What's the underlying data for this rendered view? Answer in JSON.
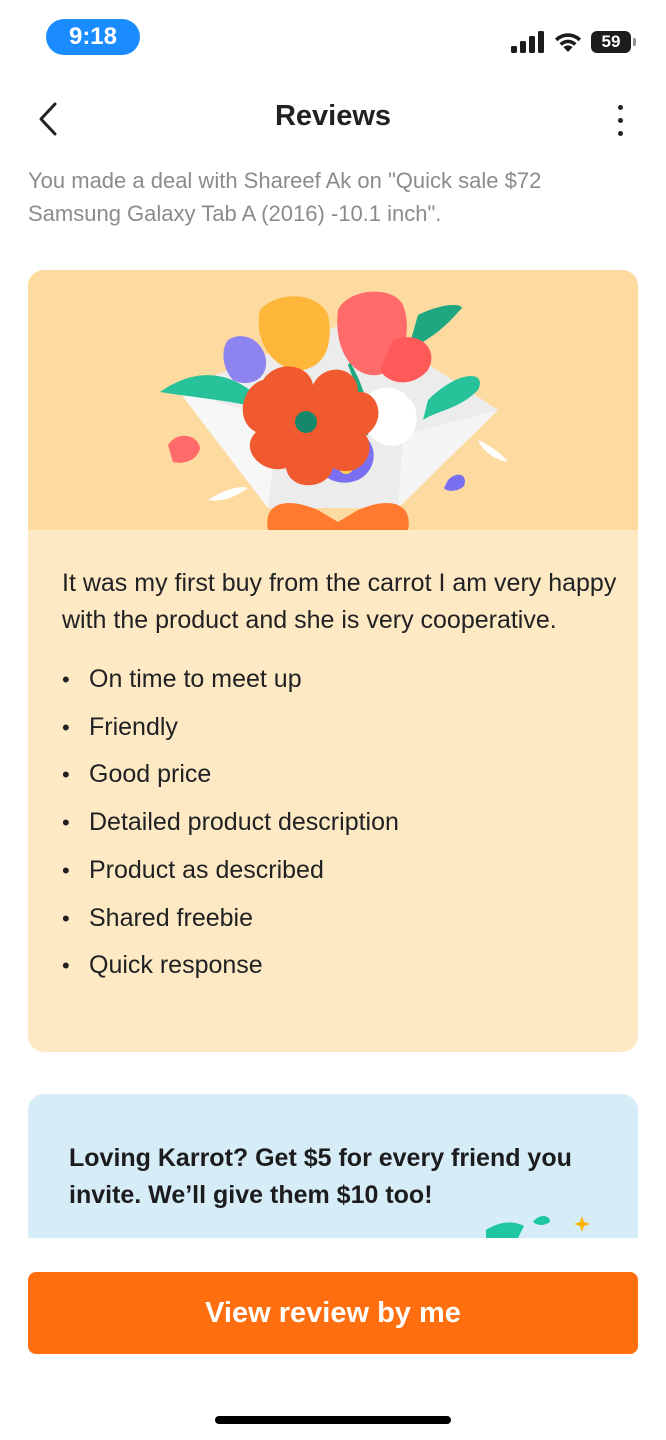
{
  "status_bar": {
    "time": "9:18",
    "battery": "59",
    "icons": [
      "signal-icon",
      "wifi-icon",
      "battery-icon"
    ]
  },
  "header": {
    "title": "Reviews",
    "back_icon": "chevron-left-icon",
    "more_icon": "more-vertical-icon"
  },
  "deal_text": "You made a deal with Shareef Ak on \"Quick sale  $72 Samsung  Galaxy Tab A (2016) -10.1 inch\".",
  "review": {
    "text": "It was my first buy from the carrot I am very happy with the product and she is very cooperative.",
    "tags": [
      "On time to meet up",
      "Friendly",
      "Good price",
      "Detailed product description",
      "Product as described",
      "Shared freebie",
      "Quick response"
    ],
    "illustration": "flower-bouquet-illustration"
  },
  "promo": {
    "text": "Loving Karrot? Get $5 for every friend you invite. We’ll give them $10 too!"
  },
  "cta": {
    "label": "View review by me"
  },
  "colors": {
    "accent": "#ff6f0f",
    "review_card_bg": "#fde9c4",
    "illustration_bg": "#fddba0",
    "promo_bg": "#d6ecf7",
    "time_pill": "#1a8cff"
  }
}
